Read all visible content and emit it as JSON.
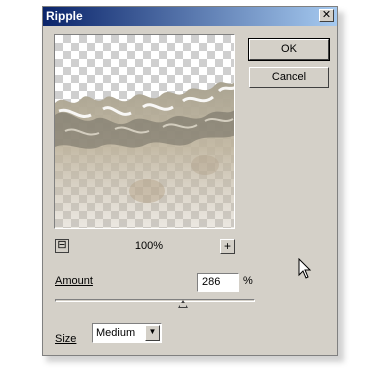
{
  "window": {
    "title": "Ripple",
    "close_glyph": "✕"
  },
  "buttons": {
    "ok": "OK",
    "cancel": "Cancel"
  },
  "preview": {
    "zoom_level": "100%",
    "zoom_out_icon": "zoom-out-icon",
    "zoom_in_glyph": "+"
  },
  "amount": {
    "label": "Amount",
    "value": "286",
    "unit": "%",
    "slider_fraction": 0.64
  },
  "size": {
    "label": "Size",
    "selected": "Medium",
    "arrow_glyph": "▼"
  },
  "colors": {
    "title_start": "#0a246a",
    "title_end": "#a6caf0",
    "dialog_bg": "#d4d0c8"
  }
}
